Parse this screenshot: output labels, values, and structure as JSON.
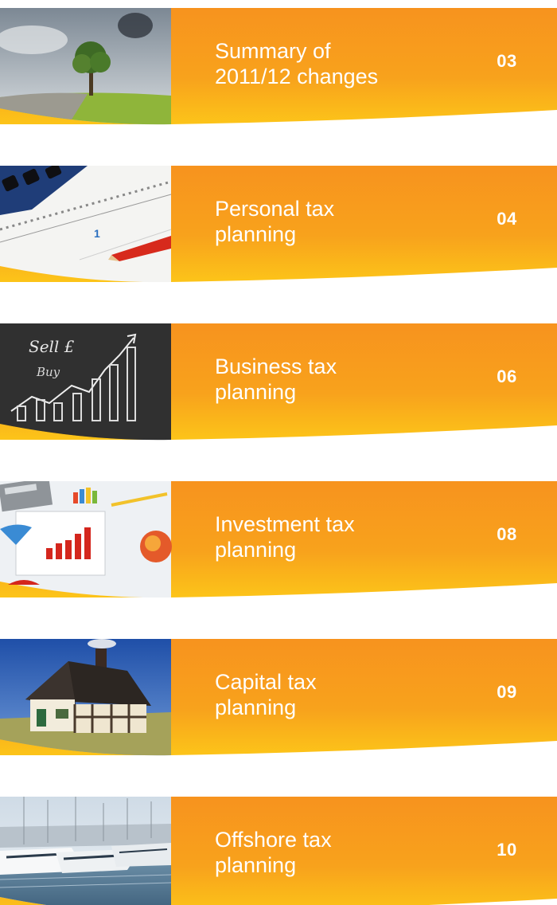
{
  "entries": [
    {
      "title_line1": "Summary of",
      "title_line2": "2011/12 changes",
      "page": "03",
      "thumbnail": "tree-between-dry-and-green-land-image"
    },
    {
      "title_line1": "Personal tax",
      "title_line2": "planning",
      "page": "04",
      "thumbnail": "calculator-calendar-pencil-image"
    },
    {
      "title_line1": "Business tax",
      "title_line2": "planning",
      "page": "06",
      "thumbnail": "chalkboard-sell-buy-chart-image"
    },
    {
      "title_line1": "Investment tax",
      "title_line2": "planning",
      "page": "08",
      "thumbnail": "financial-charts-calculator-image"
    },
    {
      "title_line1": "Capital tax",
      "title_line2": "planning",
      "page": "09",
      "thumbnail": "model-house-image"
    },
    {
      "title_line1": "Offshore tax",
      "title_line2": "planning",
      "page": "10",
      "thumbnail": "marina-yachts-image"
    }
  ],
  "colors": {
    "banner_top": "#f5901e",
    "banner_bottom": "#fbc21a",
    "text": "#ffffff"
  }
}
